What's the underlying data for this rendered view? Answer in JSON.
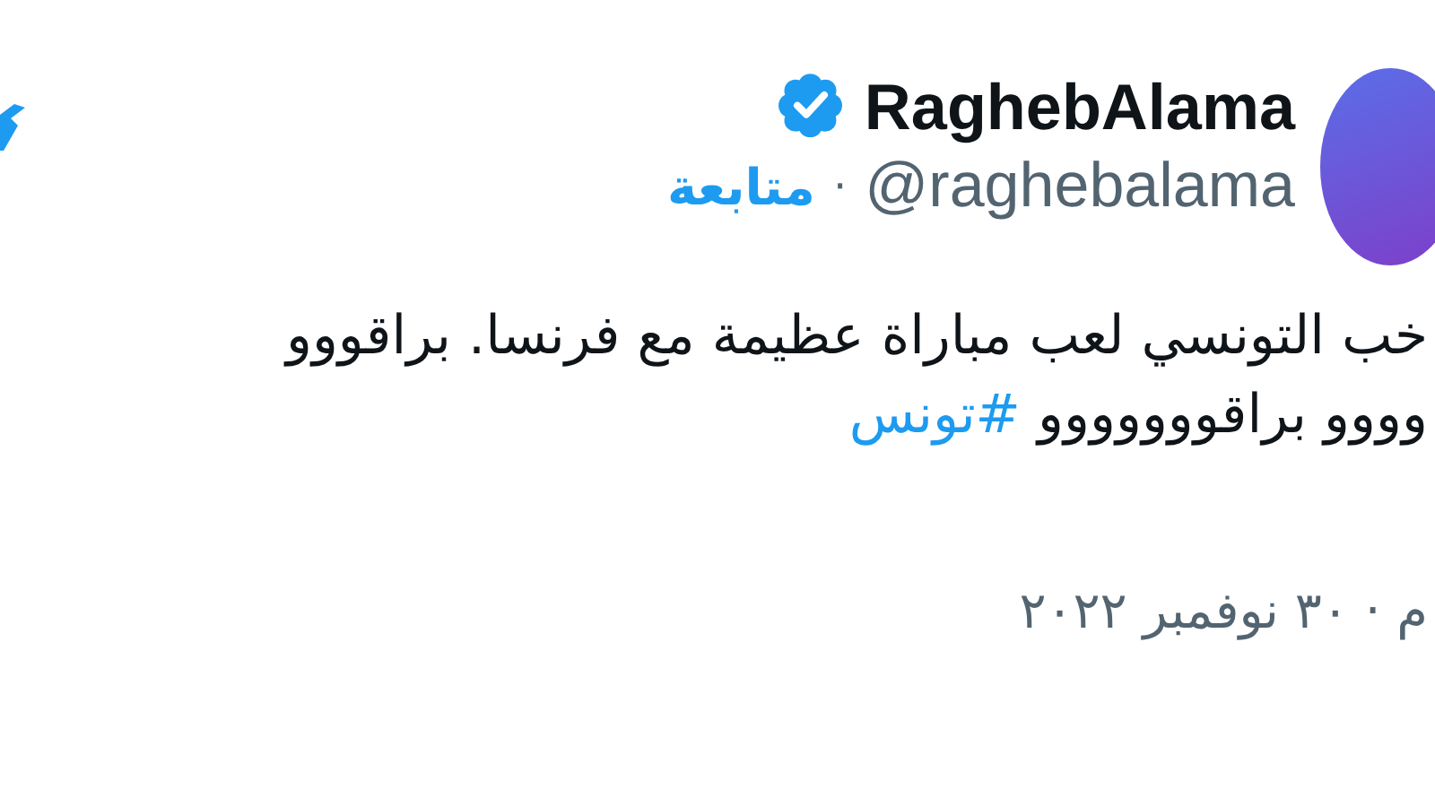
{
  "header": {
    "display_name": "RaghebAlama",
    "verified": true,
    "handle": "@raghebalama",
    "separator": "·",
    "follow_link": "متابعة"
  },
  "tweet": {
    "text_lines": [
      "خب التونسي لعب مباراة عظيمة مع فرنسا. براقووو",
      "وووو براقووووووو"
    ],
    "hashtag": "#تونس"
  },
  "timestamp": "م · ٣٠ نوفمبر ٢٠٢٢"
}
